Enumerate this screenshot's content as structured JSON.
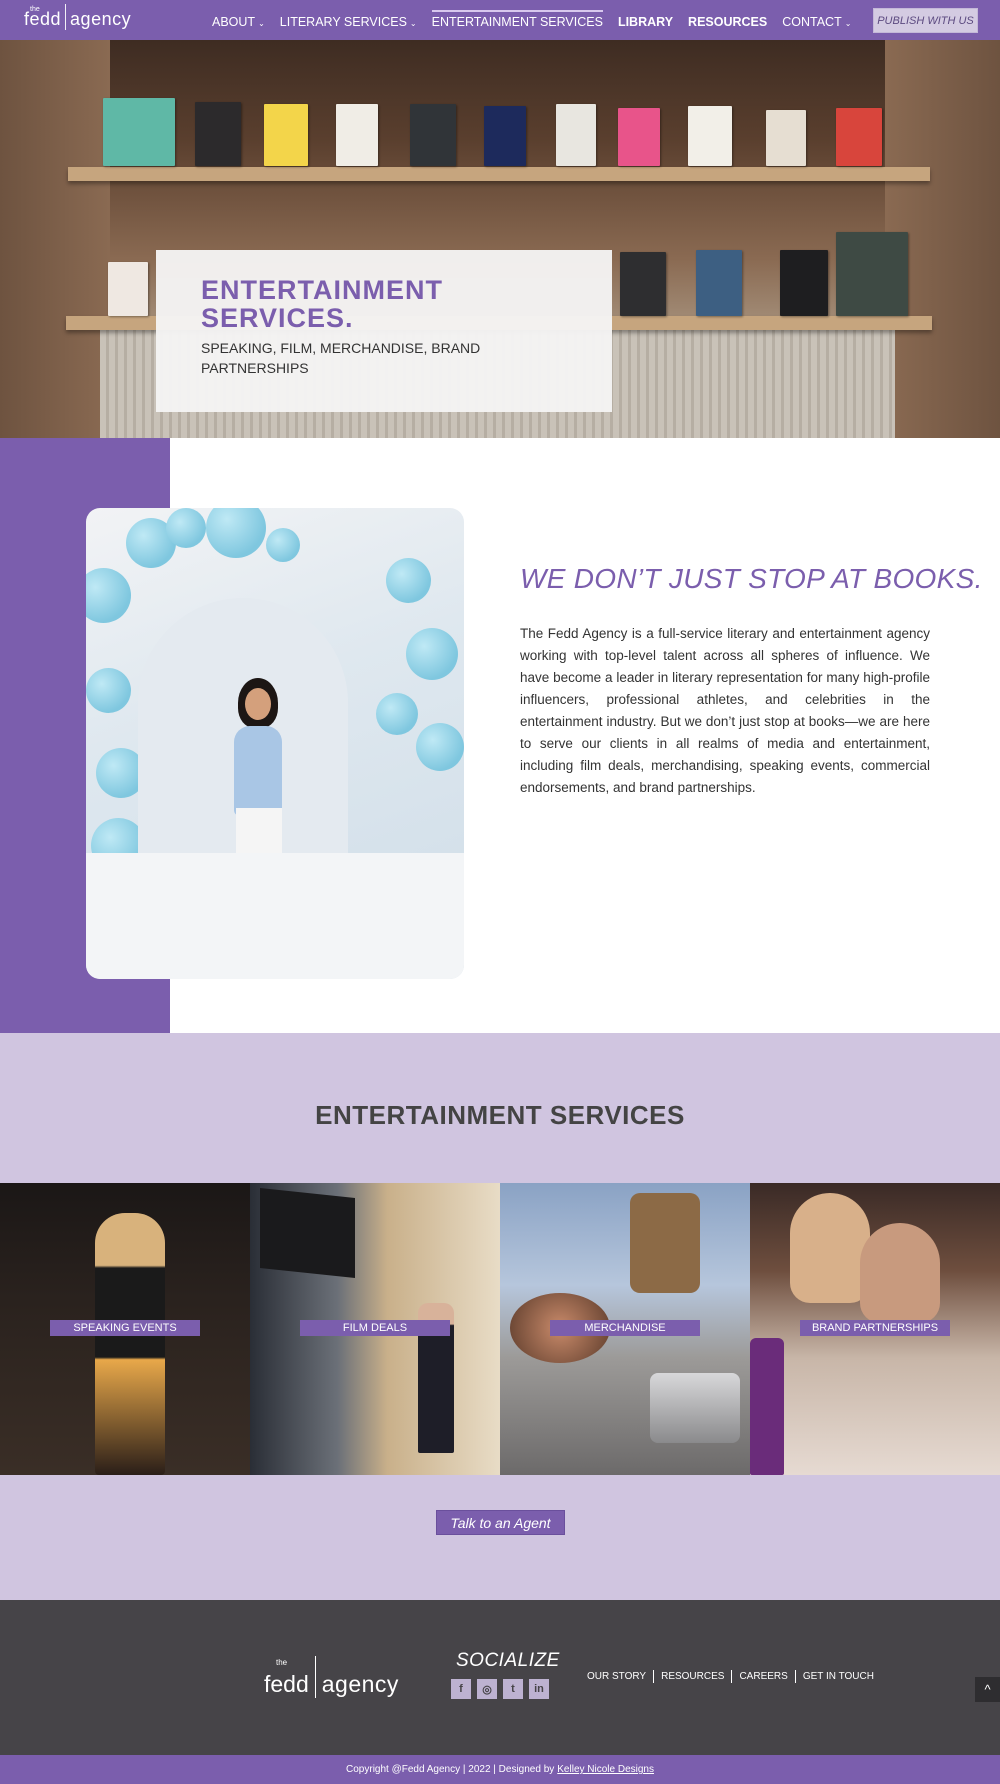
{
  "nav": {
    "logo": {
      "the": "the",
      "fedd": "fedd",
      "agency": "agency"
    },
    "items": [
      {
        "label": "About",
        "chevron": "⌄"
      },
      {
        "label": "Literary Services",
        "chevron": "⌄"
      },
      {
        "label": "Entertainment Services",
        "chevron": ""
      },
      {
        "label": "Library",
        "chevron": ""
      },
      {
        "label": "Resources",
        "chevron": ""
      },
      {
        "label": "Contact",
        "chevron": "⌄"
      }
    ],
    "publish_label": "PUBLISH WITH US"
  },
  "hero": {
    "title": "ENTERTAINMENT SERVICES.",
    "subtitle": "SPEAKING, FILM, MERCHANDISE, BRAND PARTNERSHIPS"
  },
  "about": {
    "heading": "WE DON’T JUST STOP AT BOOKS.",
    "body": "The Fedd Agency is a full-service literary and entertainment agency working with top-level talent across all spheres of influence. We have become a leader in literary representation for many high-profile influencers, professional athletes, and celebrities in the entertainment industry. But we don’t just stop at books—we are here to serve our clients in all realms of media and entertainment, including film deals, merchandising, speaking events, commercial endorsements, and brand partnerships."
  },
  "services": {
    "title": "ENTERTAINMENT SERVICES",
    "tiles": [
      {
        "label": "Speaking Events"
      },
      {
        "label": "Film Deals"
      },
      {
        "label": "Merchandise"
      },
      {
        "label": "Brand Partnerships"
      }
    ],
    "cta": "Talk to an Agent"
  },
  "footer": {
    "logo": {
      "the": "the",
      "fedd": "fedd",
      "agency": "agency"
    },
    "socialize": "SOCIALIZE",
    "social": [
      {
        "icon": "facebook-icon",
        "glyph": "f"
      },
      {
        "icon": "instagram-icon",
        "glyph": "◎"
      },
      {
        "icon": "twitter-icon",
        "glyph": "t"
      },
      {
        "icon": "linkedin-icon",
        "glyph": "in"
      }
    ],
    "links": [
      "OUR STORY",
      "RESOURCES",
      "CAREERS",
      "GET IN TOUCH"
    ],
    "back_to_top": "^",
    "copyright": "Copyright @Fedd Agency | 2022 | Designed by",
    "designer": "Kelley Nicole Designs"
  },
  "colors": {
    "brand": "#7b5ead",
    "lavender": "#d0c5e0",
    "footer": "#464448"
  }
}
